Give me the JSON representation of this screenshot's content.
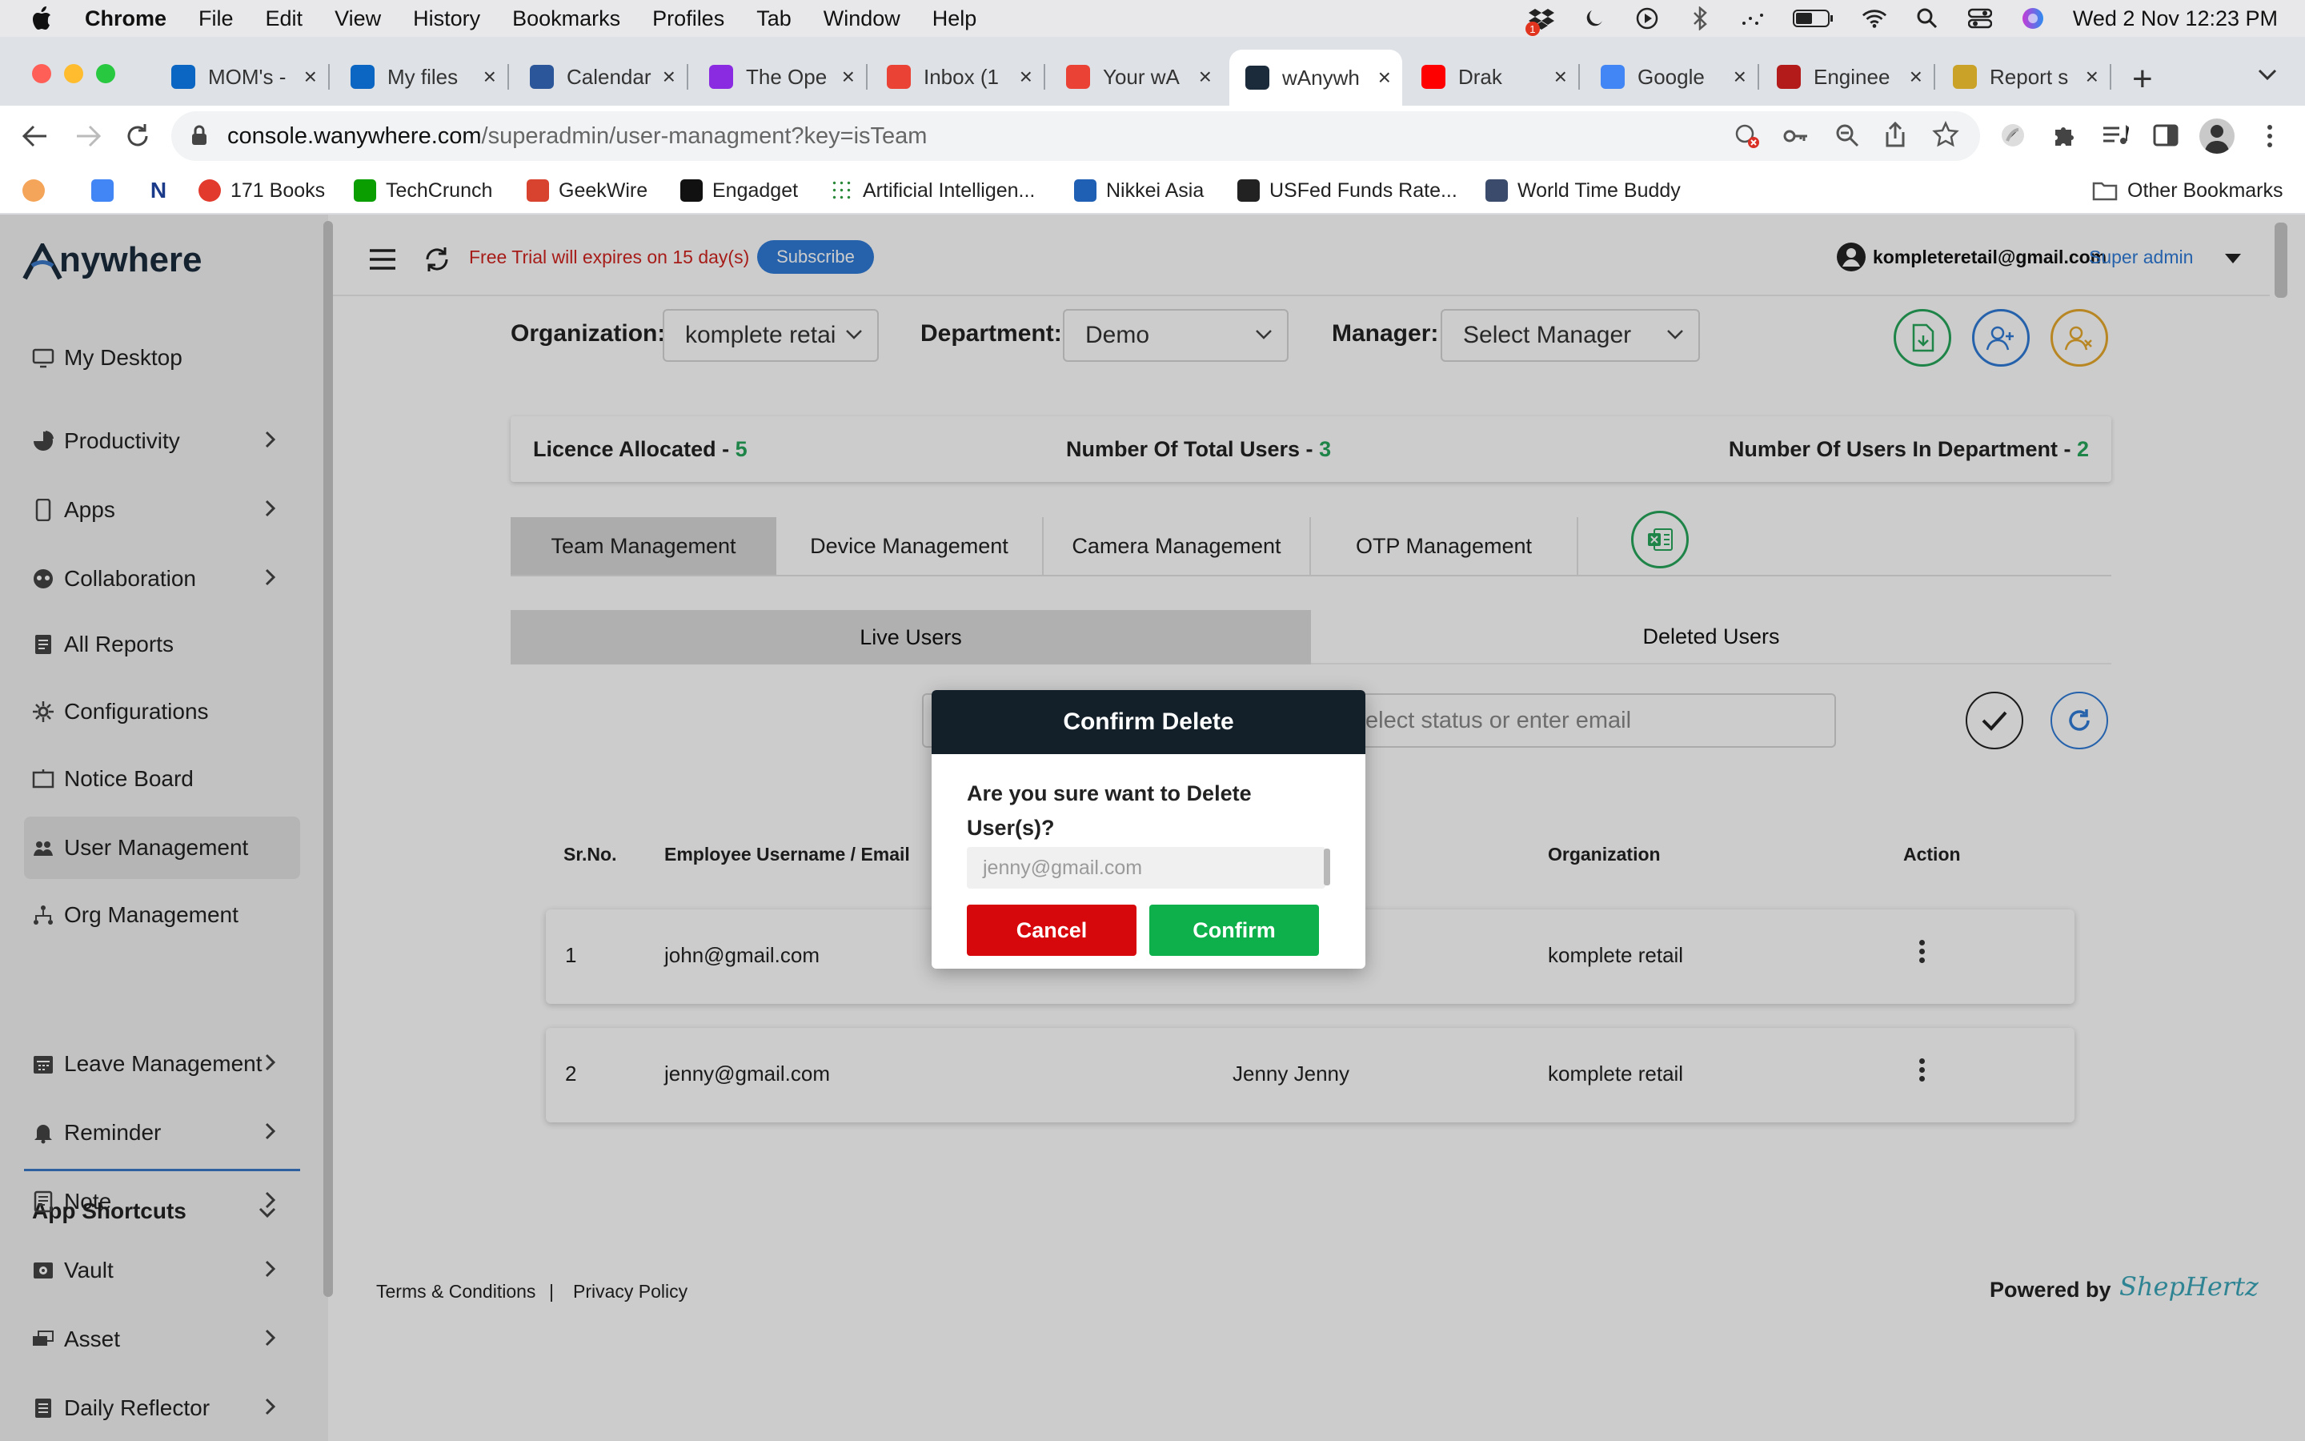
{
  "menubar": {
    "app": "Chrome",
    "items": [
      "File",
      "Edit",
      "View",
      "History",
      "Bookmarks",
      "Profiles",
      "Tab",
      "Window",
      "Help"
    ],
    "clock": "Wed 2 Nov  12:23 PM",
    "dropbox_badge": "1"
  },
  "browser": {
    "tabs": [
      {
        "title": "MOM's -",
        "color": "#0a66c2"
      },
      {
        "title": "My files",
        "color": "#0a66c2"
      },
      {
        "title": "Calendar",
        "color": "#2b579a"
      },
      {
        "title": "The Ope",
        "color": "#8a2be2"
      },
      {
        "title": "Inbox (1",
        "color": "#ea4335"
      },
      {
        "title": "Your wA",
        "color": "#ea4335"
      },
      {
        "title": "wAnywh",
        "color": "#1b2b3c"
      },
      {
        "title": "Drak",
        "color": "#ff0000"
      },
      {
        "title": "Google",
        "color": "#4285f4"
      },
      {
        "title": "Enginee",
        "color": "#b31b1b"
      },
      {
        "title": "Report s",
        "color": "#c9a227"
      }
    ],
    "url_host": "console.wanywhere.com",
    "url_path": "/superadmin/user-managment?key=isTeam",
    "bookmarks": [
      "171 Books",
      "TechCrunch",
      "GeekWire",
      "Engadget",
      "Artificial Intelligen...",
      "Nikkei Asia",
      "USFed Funds Rate...",
      "World Time Buddy"
    ],
    "other_bookmarks": "Other Bookmarks"
  },
  "sidebar": {
    "logo": "Anywhere",
    "items": [
      {
        "label": "My Desktop",
        "chevron": false
      },
      {
        "label": "Productivity",
        "chevron": true
      },
      {
        "label": "Apps",
        "chevron": true
      },
      {
        "label": "Collaboration",
        "chevron": true
      },
      {
        "label": "All Reports",
        "chevron": false
      },
      {
        "label": "Configurations",
        "chevron": false
      },
      {
        "label": "Notice Board",
        "chevron": false
      },
      {
        "label": "User Management",
        "chevron": false
      },
      {
        "label": "Org Management",
        "chevron": false
      }
    ],
    "shortcuts_title": "App Shortcuts",
    "shortcuts": [
      {
        "label": "Leave Management"
      },
      {
        "label": "Reminder"
      },
      {
        "label": "Note"
      },
      {
        "label": "Vault"
      },
      {
        "label": "Asset"
      },
      {
        "label": "Daily Reflector"
      }
    ]
  },
  "header": {
    "trial_text": "Free Trial will expires on 15 day(s)",
    "subscribe": "Subscribe",
    "user_email": "kompleteretail@gmail.com",
    "user_role": "Super admin"
  },
  "filters": {
    "org_label": "Organization:",
    "org_value": "komplete retai",
    "dept_label": "Department:",
    "dept_value": "Demo",
    "manager_label": "Manager:",
    "manager_value": "Select Manager"
  },
  "stats": {
    "licence_label": "Licence Allocated - ",
    "licence_value": "5",
    "total_label": "Number Of Total Users - ",
    "total_value": "3",
    "dept_label": "Number Of Users In Department - ",
    "dept_value": "2"
  },
  "tabs": [
    "Team Management",
    "Device Management",
    "Camera Management",
    "OTP Management"
  ],
  "user_tabs": {
    "live": "Live Users",
    "deleted": "Deleted Users"
  },
  "search": {
    "placeholder": "elect status or enter email"
  },
  "table": {
    "headers": {
      "sr": "Sr.No.",
      "email": "Employee Username / Email",
      "org": "Organization",
      "action": "Action"
    },
    "rows": [
      {
        "sr": "1",
        "email": "john@gmail.com",
        "name": "",
        "org": "komplete retail"
      },
      {
        "sr": "2",
        "email": "jenny@gmail.com",
        "name": "Jenny Jenny",
        "org": "komplete retail"
      }
    ]
  },
  "footer": {
    "terms": "Terms & Conditions",
    "sep": "|",
    "privacy": "Privacy Policy",
    "powered": "Powered by",
    "brand": "ShepHertz"
  },
  "dialog": {
    "title": "Confirm Delete",
    "question": "Are you sure want to Delete User(s)?",
    "email": "jenny@gmail.com",
    "cancel": "Cancel",
    "confirm": "Confirm"
  },
  "colors": {
    "accent_green": "#26a65b",
    "cancel_red": "#d6080c",
    "confirm_green": "#0db04b",
    "header_dark": "#13202a",
    "link_blue": "#2f7bd6",
    "trial_red": "#d0231f"
  }
}
